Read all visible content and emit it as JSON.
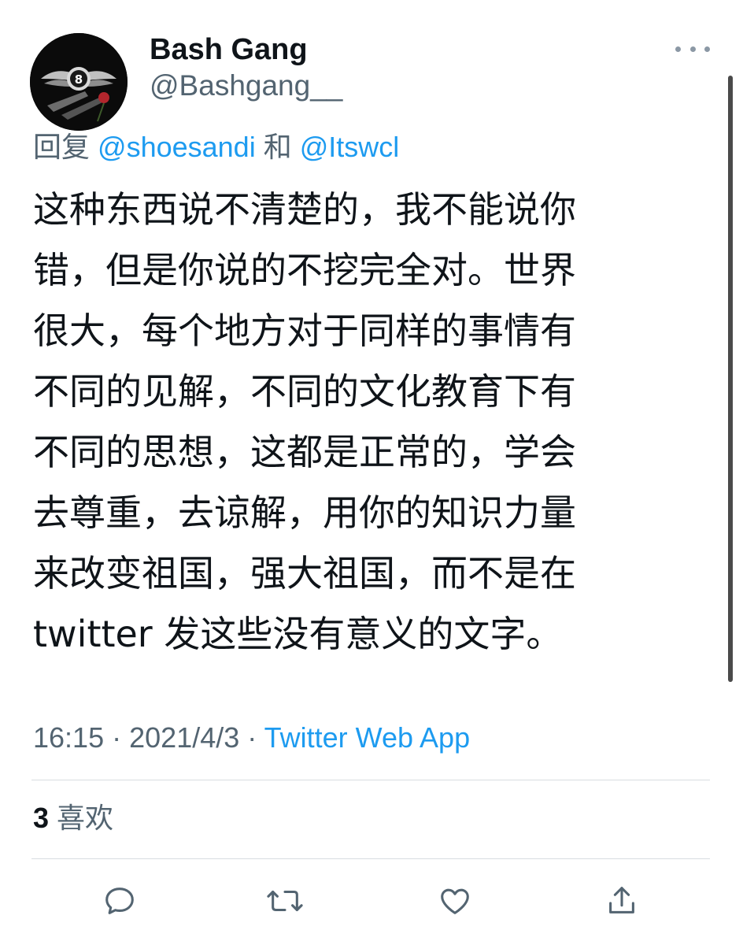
{
  "user": {
    "display_name": "Bash Gang",
    "handle": "@Bashgang__",
    "avatar_icon": "winged-8-ball-icon"
  },
  "reply": {
    "prefix": "回复",
    "mention_1": "@shoesandi",
    "joiner": "和",
    "mention_2": "@Itswcl"
  },
  "tweet": {
    "lines": [
      "这种东西说不清楚的，我不能说你",
      "错，但是你说的不挖完全对。世界",
      "很大，每个地方对于同样的事情有",
      "不同的见解，不同的文化教育下有",
      "不同的思想，这都是正常的，学会",
      "去尊重，去谅解，用你的知识力量",
      "来改变祖国，强大祖国，而不是在",
      "twitter 发这些没有意义的文字。"
    ]
  },
  "meta": {
    "time": "16:15",
    "separator": "·",
    "date": "2021/4/3",
    "source": "Twitter Web App"
  },
  "likes": {
    "count": "3",
    "label": "喜欢"
  },
  "actions": [
    {
      "name": "reply",
      "icon": "comment-icon"
    },
    {
      "name": "retweet",
      "icon": "retweet-icon"
    },
    {
      "name": "like",
      "icon": "heart-icon"
    },
    {
      "name": "share",
      "icon": "share-icon"
    }
  ],
  "colors": {
    "accent": "#1d9bf0",
    "secondary_text": "#536471",
    "primary_text": "#0f1419",
    "divider": "#d8dde1"
  }
}
